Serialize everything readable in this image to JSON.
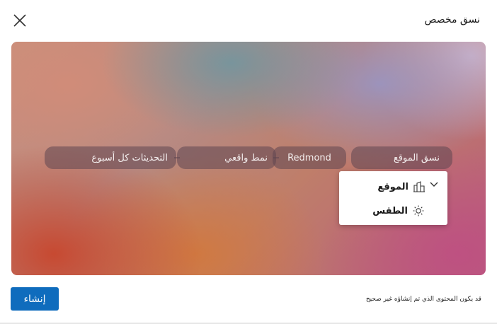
{
  "dialog": {
    "title": "نسق مخصص",
    "close_icon": "close-icon"
  },
  "canvas": {
    "pills": {
      "custom_style": "نسق الموقع",
      "location_value": "Redmond",
      "photo_style": "نمط واقعي",
      "updates": "التحديثات كل أسبوع"
    }
  },
  "dropdown": {
    "items": [
      {
        "label": "الموقع",
        "icon": "location-building-icon"
      },
      {
        "label": "الطقس",
        "icon": "sun-icon"
      }
    ],
    "chevron_icon": "chevron-down-icon"
  },
  "footer": {
    "disclaimer": "قد يكون المحتوى الذي تم إنشاؤه غير صحيح",
    "create_label": "إنشاء"
  },
  "colors": {
    "accent": "#0f6cbd",
    "pill_bg": "rgba(95,70,80,0.55)"
  }
}
